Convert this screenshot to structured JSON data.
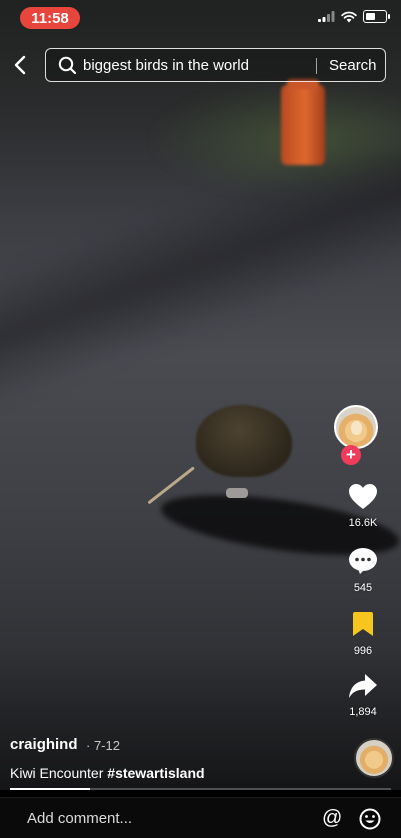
{
  "status_bar": {
    "time": "11:58"
  },
  "search": {
    "query": "biggest birds in the world",
    "button_label": "Search"
  },
  "rail": {
    "likes": "16.6K",
    "comments": "545",
    "saves": "996",
    "shares": "1,894",
    "follow_symbol": "+"
  },
  "post": {
    "username": "craighind",
    "date": "· 7-12",
    "caption_text": "Kiwi Encounter ",
    "hashtag": "#stewartisland",
    "progress": 0.21
  },
  "comment_bar": {
    "placeholder": "Add comment...",
    "mention_symbol": "@"
  },
  "colors": {
    "accent_red": "#e8453c",
    "follow_pink": "#f03c5a",
    "save_yellow": "#f6c61e"
  }
}
